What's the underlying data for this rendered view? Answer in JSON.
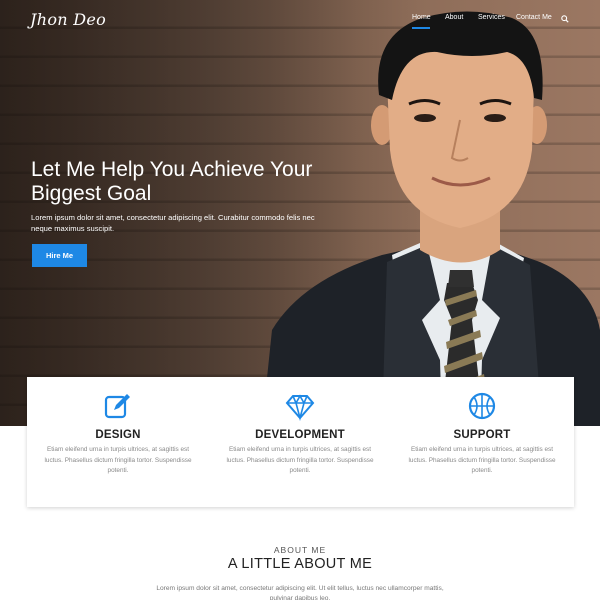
{
  "brand": {
    "logo_text": "Jhon Deo"
  },
  "nav": {
    "items": [
      {
        "label": "Home",
        "active": true
      },
      {
        "label": "About",
        "active": false
      },
      {
        "label": "Services",
        "active": false
      },
      {
        "label": "Contact Me",
        "active": false
      }
    ],
    "search_icon": "search-icon"
  },
  "hero": {
    "title": "Let Me Help You Achieve Your Biggest Goal",
    "text": "Lorem ipsum dolor sit amet, consectetur adipiscing elit. Curabitur commodo felis nec neque maximus suscipit.",
    "cta_label": "Hire Me"
  },
  "services": [
    {
      "icon": "edit-icon",
      "title": "DESIGN",
      "text": "Etiam eleifend urna in turpis ultrices, at sagittis est luctus. Phasellus dictum fringilla tortor. Suspendisse potenti."
    },
    {
      "icon": "diamond-icon",
      "title": "DEVELOPMENT",
      "text": "Etiam eleifend urna in turpis ultrices, at sagittis est luctus. Phasellus dictum fringilla tortor. Suspendisse potenti."
    },
    {
      "icon": "basketball-icon",
      "title": "SUPPORT",
      "text": "Etiam eleifend urna in turpis ultrices, at sagittis est luctus. Phasellus dictum fringilla tortor. Suspendisse potenti."
    }
  ],
  "about": {
    "kicker": "ABOUT ME",
    "title": "A LITTLE ABOUT ME",
    "text": "Lorem ipsum dolor sit amet, consectetur adipiscing elit. Ut elit tellus, luctus nec ullamcorper mattis, pulvinar dapibus leo."
  },
  "colors": {
    "accent": "#1e88e5",
    "heading": "#222222",
    "body_text": "#8a8a8a"
  }
}
